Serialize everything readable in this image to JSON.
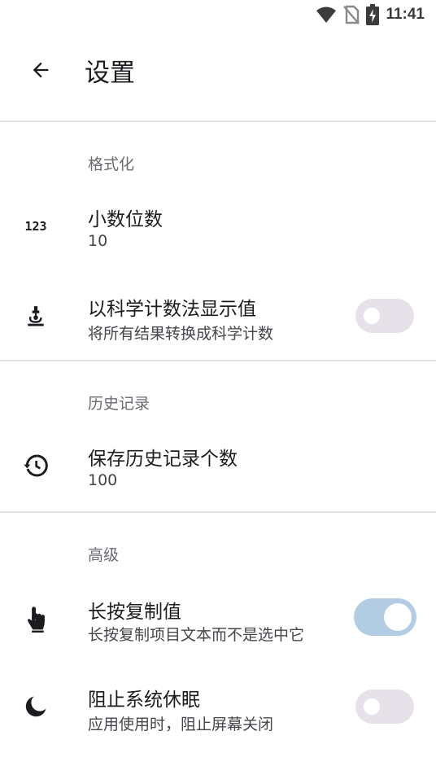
{
  "status_bar": {
    "time": "11:41"
  },
  "header": {
    "title": "设置"
  },
  "sections": [
    {
      "title": "格式化",
      "items": [
        {
          "label": "小数位数",
          "summary": "10",
          "icon": "numbers-123-icon"
        },
        {
          "label": "以科学计数法显示值",
          "summary": "将所有结果转换成科学计数",
          "icon": "microscope-icon",
          "switch_on": false
        }
      ]
    },
    {
      "title": "历史记录",
      "items": [
        {
          "label": "保存历史记录个数",
          "summary": "100",
          "icon": "history-icon"
        }
      ]
    },
    {
      "title": "高级",
      "items": [
        {
          "label": "长按复制值",
          "summary": "长按复制项目文本而不是选中它",
          "icon": "touch-icon",
          "switch_on": true
        },
        {
          "label": "阻止系统休眠",
          "summary": "应用使用时，阻止屏幕关闭",
          "icon": "moon-icon",
          "switch_on": false
        }
      ]
    }
  ],
  "icons": {
    "icon_123_text": "123"
  },
  "colors": {
    "accent_switch_track_on": "#b2cde3",
    "switch_track_off": "#e7e1ea",
    "divider": "#e6e3e8"
  }
}
